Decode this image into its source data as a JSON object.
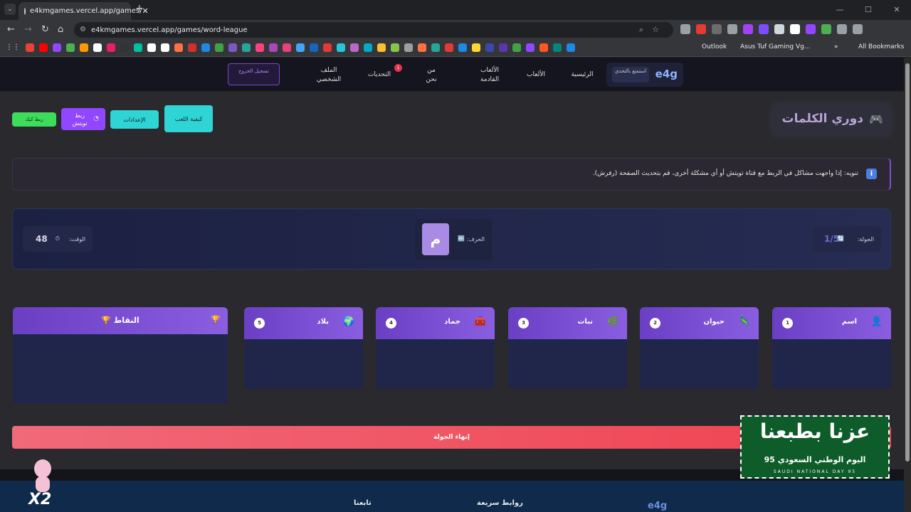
{
  "browser": {
    "tab_title": "e4kmgames.vercel.app/games/",
    "tab_close": "✕",
    "new_tab": "+",
    "url": "e4kmgames.vercel.app/games/word-league",
    "bookmarks": {
      "outlook": "Outlook",
      "asus": "Asus Tuf Gaming Vg...",
      "all": "All Bookmarks"
    },
    "ext_colors": [
      "#9aa0a6",
      "#e53935",
      "#6c6c6c",
      "#9aa0a6",
      "#a142f4",
      "#7c4dff",
      "#cfd8dc",
      "#ffffff",
      "#9146ff",
      "#4caf50",
      "#9aa0a6",
      "#9aa0a6"
    ],
    "bm_colors": [
      "#ea4335",
      "#ff0000",
      "#9146ff",
      "#4caf50",
      "#ff9900",
      "#ffffff",
      "#e91e63",
      "#333333",
      "#00bfa5",
      "#ffffff",
      "#ffffff",
      "#ff7043",
      "#d32f2f",
      "#1e88e5",
      "#43a047",
      "#7e57c2",
      "#26a69a",
      "#ff4081",
      "#ab47bc",
      "#ec407a",
      "#42a5f5",
      "#1565c0",
      "#e53935",
      "#26c6da",
      "#ba68c8",
      "#00acc1",
      "#fbc02d",
      "#8bc34a",
      "#9e9e9e",
      "#ff7043",
      "#26a69a",
      "#e53935",
      "#1e88e5",
      "#fdd835",
      "#3949ab",
      "#5e35b1",
      "#43a047",
      "#9146ff",
      "#ff5722",
      "#00897b",
      "#1e88e5"
    ]
  },
  "nav": {
    "logo": "e4g",
    "tagline": "استمتع بالتحدي",
    "links": {
      "home": "الرئيسية",
      "games": "الألعاب",
      "upcoming": "الألعاب القادمة",
      "about": "من نحن",
      "challenges": "التحديات",
      "profile": "الملف الشخصي"
    },
    "challenges_badge": "1",
    "logout": "تسجيل الخروج"
  },
  "page": {
    "title": "دوري الكلمات",
    "how_to": "كيفية اللعب",
    "settings": "الإعدادات",
    "twitch": "ربط تويتش",
    "kick": "ربط كيك"
  },
  "notice": "تنويه: إذا واجهت مشاكل في الربط مع قناة تويتش أو أي مشكلة أخرى، قم بتحديث الصفحة (رفرش).",
  "game": {
    "round_label": "الجولة:",
    "round_value": "1/5",
    "letter_label": "الحرف:",
    "letter": "م",
    "time_label": "الوقت:",
    "time_value": "48"
  },
  "categories": [
    {
      "name": "اسم",
      "num": "1",
      "icon": "👤"
    },
    {
      "name": "حيوان",
      "num": "2",
      "icon": "🦎"
    },
    {
      "name": "نبات",
      "num": "3",
      "icon": "🌿"
    },
    {
      "name": "جماد",
      "num": "4",
      "icon": "🧰"
    },
    {
      "name": "بلاد",
      "num": "5",
      "icon": "🌍"
    }
  ],
  "points": {
    "title": "النقاط",
    "icon": "🏆"
  },
  "end_round": "إنهاء الجولة",
  "footer": {
    "logo": "e4g",
    "quick_links": "روابط سريعة",
    "follow": "تابعنا"
  },
  "national_day": {
    "big": "عزنا بطبعنا",
    "mid": "اليوم الوطني السعودي 95",
    "sm": "SAUDI NATIONAL DAY 95"
  },
  "mascot": {
    "label": "X2"
  }
}
